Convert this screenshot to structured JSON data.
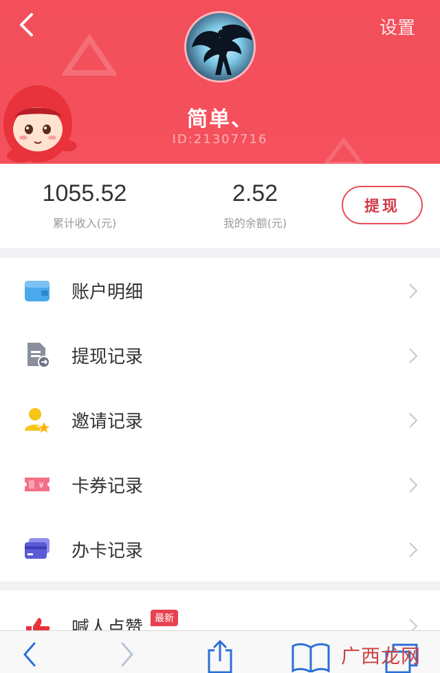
{
  "header": {
    "settings_label": "设置",
    "username": "简单、",
    "user_id": "ID:21307716",
    "colors": {
      "bg": "#f24f5a",
      "accent": "#e84b58"
    }
  },
  "stats": {
    "total_income": {
      "value": "1055.52",
      "label": "累计收入(元)"
    },
    "balance": {
      "value": "2.52",
      "label": "我的余额(元)"
    },
    "withdraw_label": "提现"
  },
  "menu": {
    "items": [
      {
        "label": "账户明细",
        "icon": "wallet-icon"
      },
      {
        "label": "提现记录",
        "icon": "document-icon"
      },
      {
        "label": "邀请记录",
        "icon": "user-star-icon"
      },
      {
        "label": "卡券记录",
        "icon": "coupon-icon"
      },
      {
        "label": "办卡记录",
        "icon": "card-icon"
      }
    ],
    "extra": {
      "label": "喊人点赞",
      "badge": "最新",
      "icon": "thumbs-up-icon"
    }
  },
  "toolbar": {
    "icons": [
      "back-arrow-icon",
      "forward-arrow-icon",
      "share-icon",
      "bookmarks-icon",
      "tabs-icon"
    ]
  },
  "watermark": "广西龙网"
}
